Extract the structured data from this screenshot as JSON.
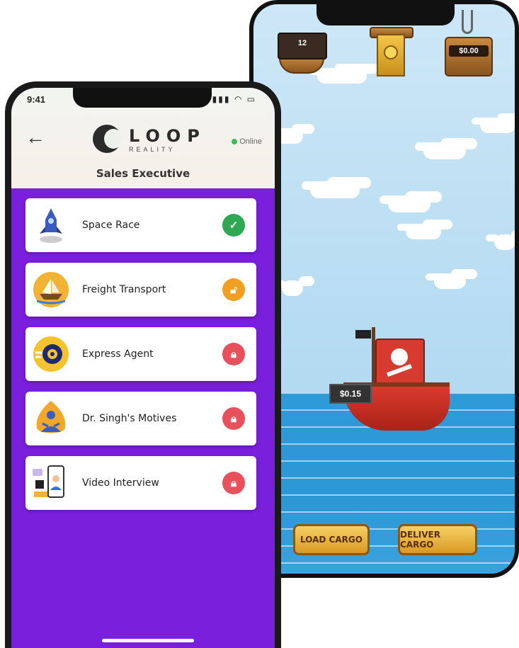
{
  "colors": {
    "accent_purple": "#7a1fdc",
    "status_done": "#2ea853",
    "status_unlocked": "#f0a020",
    "status_locked": "#e8505b"
  },
  "front_phone": {
    "status_bar": {
      "time": "9:41"
    },
    "header": {
      "logo_text": "LOOP",
      "logo_subtext": "REALITY",
      "online_label": "Online",
      "title": "Sales Executive"
    },
    "modules": [
      {
        "label": "Space Race",
        "icon": "rocket-icon",
        "status": "completed",
        "status_icon": "checkmark-icon"
      },
      {
        "label": "Freight Transport",
        "icon": "ship-icon",
        "status": "unlocked",
        "status_icon": "unlock-icon"
      },
      {
        "label": "Express Agent",
        "icon": "wheel-icon",
        "status": "locked",
        "status_icon": "lock-icon"
      },
      {
        "label": "Dr. Singh's Motives",
        "icon": "meditation-icon",
        "status": "locked",
        "status_icon": "lock-icon"
      },
      {
        "label": "Video Interview",
        "icon": "video-call-icon",
        "status": "locked",
        "status_icon": "lock-icon"
      }
    ]
  },
  "back_phone": {
    "hud": {
      "ship_count": "12",
      "balance": "$0.00"
    },
    "ship_cargo_value": "$0.15",
    "buttons": {
      "load_cargo": "LOAD CARGO",
      "deliver_cargo": "DELIVER CARGO"
    }
  }
}
